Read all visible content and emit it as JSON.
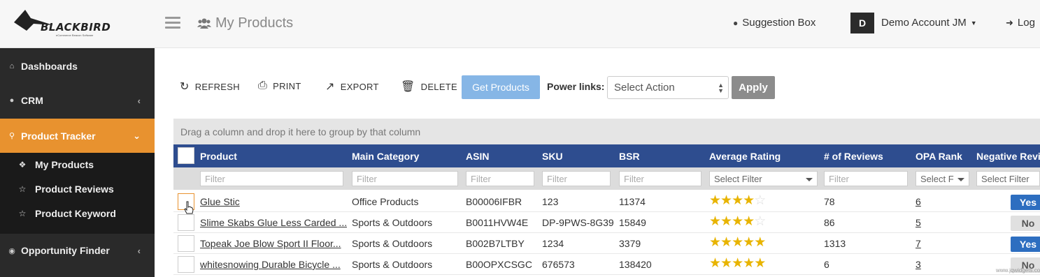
{
  "app": {
    "logo_text": "BLACKBIRD",
    "logo_subtext": "eCommerce Beacon Software"
  },
  "header": {
    "page_title": "My Products",
    "suggestion_box": "Suggestion Box",
    "avatar_initial": "D",
    "account_name": "Demo Account JM",
    "logout": "Log"
  },
  "sidebar": {
    "items": [
      {
        "label": "Dashboards",
        "icon": "home-icon"
      },
      {
        "label": "CRM",
        "icon": "users-icon"
      },
      {
        "label": "Product Tracker",
        "icon": "map-marker-icon"
      },
      {
        "label": "Opportunity Finder",
        "icon": "binoculars-icon"
      }
    ],
    "subitems": [
      {
        "label": "My Products",
        "icon": "cubes-icon"
      },
      {
        "label": "Product Reviews",
        "icon": "star-half-icon"
      },
      {
        "label": "Product Keyword",
        "icon": "star-half-icon"
      }
    ]
  },
  "toolbar": {
    "refresh": "REFRESH",
    "print": "PRINT",
    "export": "EXPORT",
    "delete": "DELETE",
    "get_products": "Get Products",
    "power_links_label": "Power links:",
    "select_action": "Select Action",
    "apply": "Apply"
  },
  "grid": {
    "group_hint": "Drag a column and drop it here to group by that column",
    "columns": [
      "Product",
      "Main Category",
      "ASIN",
      "SKU",
      "BSR",
      "Average Rating",
      "# of Reviews",
      "OPA Rank",
      "Negative Revi"
    ],
    "filters": {
      "text_placeholder": "Filter",
      "select_placeholder": "Select Filter",
      "opa_placeholder": "Select F"
    },
    "rows": [
      {
        "product": "Glue Stic",
        "category": "Office Products",
        "asin": "B00006IFBR",
        "sku": "123",
        "bsr": "11374",
        "rating": 4,
        "reviews": "78",
        "opa_rank": "6",
        "negative": "Yes"
      },
      {
        "product": "Slime Skabs Glue Less Carded ...",
        "category": "Sports & Outdoors",
        "asin": "B0011HVW4E",
        "sku": "DP-9PWS-8G39",
        "bsr": "15849",
        "rating": 4,
        "reviews": "86",
        "opa_rank": "5",
        "negative": "No"
      },
      {
        "product": "Topeak Joe Blow Sport II Floor...",
        "category": "Sports & Outdoors",
        "asin": "B002B7LTBY",
        "sku": "1234",
        "bsr": "3379",
        "rating": 5,
        "reviews": "1313",
        "opa_rank": "7",
        "negative": "Yes"
      },
      {
        "product": "whitesnowing Durable Bicycle ...",
        "category": "Sports & Outdoors",
        "asin": "B00OPXCSGC",
        "sku": "676573",
        "bsr": "138420",
        "rating": 5,
        "reviews": "6",
        "opa_rank": "3",
        "negative": "No"
      }
    ]
  },
  "watermark": "www.jqwidgets.com",
  "colors": {
    "sidebar_bg": "#2a2a2a",
    "active_nav": "#e8922f",
    "grid_header": "#2e4d8f",
    "get_products_btn": "#86b6e6",
    "star": "#e8b400",
    "yes_badge": "#2d6ec0"
  }
}
